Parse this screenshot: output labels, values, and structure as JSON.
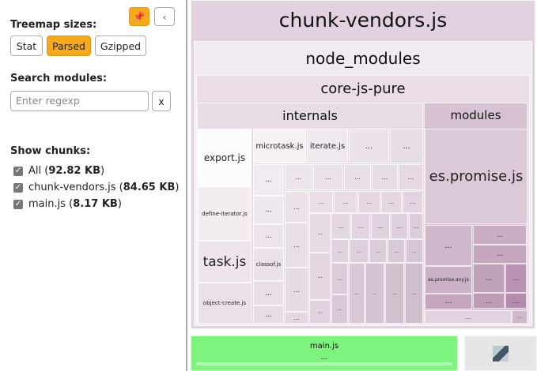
{
  "sidebar": {
    "treemap_sizes_label": "Treemap sizes:",
    "size_options": [
      "Stat",
      "Parsed",
      "Gzipped"
    ],
    "selected_size": "Parsed",
    "search_label": "Search modules:",
    "search_placeholder": "Enter regexp",
    "clear_label": "x",
    "show_chunks_label": "Show chunks:",
    "chunks": [
      {
        "name": "All",
        "size": "92.82 KB",
        "checked": true
      },
      {
        "name": "chunk-vendors.js",
        "size": "84.65 KB",
        "checked": true
      },
      {
        "name": "main.js",
        "size": "8.17 KB",
        "checked": true
      }
    ],
    "pin_icon": "pin-icon",
    "collapse_icon": "chevron-left-icon",
    "accent": "#f8a91a"
  },
  "treemap": {
    "vendors": "chunk-vendors.js",
    "node_modules": "node_modules",
    "core_js": "core-js-pure",
    "internals": "internals",
    "modules": "modules",
    "export": "export.js",
    "microtask": "microtask.js",
    "iterate": "iterate.js",
    "define_iterator": "define-iterator.js",
    "task": "task.js",
    "classof": "classof.js",
    "object_create": "object-create.js",
    "es_promise": "es.promise.js",
    "es_promise_any": "es.promise.any.js",
    "ellipsis": "...",
    "main": "main.js",
    "colors": {
      "vendors": "#e2d2e0",
      "main": "#7ef47e"
    }
  }
}
